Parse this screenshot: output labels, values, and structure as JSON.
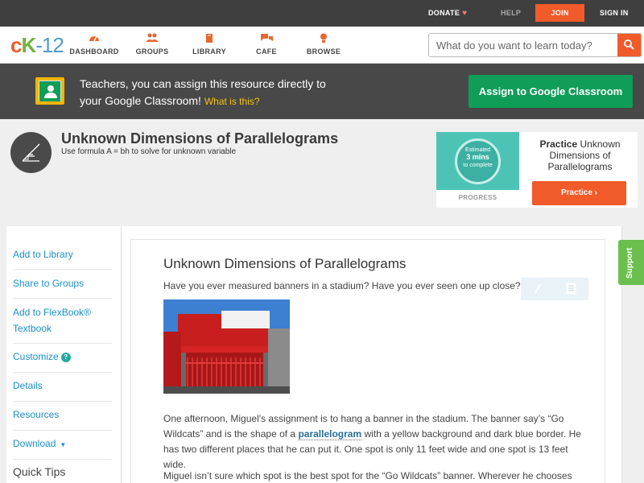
{
  "topbar": {
    "donate": "DONATE",
    "help": "HELP",
    "join": "JOIN",
    "signin": "SIGN IN"
  },
  "nav": {
    "logo": {
      "c": "c",
      "k": "K",
      "n": "-12"
    },
    "items": [
      {
        "label": "DASHBOARD",
        "icon": "dashboard-icon"
      },
      {
        "label": "GROUPS",
        "icon": "groups-icon"
      },
      {
        "label": "LIBRARY",
        "icon": "library-icon"
      },
      {
        "label": "CAFE",
        "icon": "cafe-icon"
      },
      {
        "label": "BROWSE",
        "icon": "browse-icon"
      }
    ],
    "search_placeholder": "What do you want to learn today?"
  },
  "classroom": {
    "text_line1": "Teachers, you can assign this resource directly to",
    "text_line2": "your Google Classroom!",
    "what": "What is this?",
    "button": "Assign to Google Classroom"
  },
  "lesson": {
    "title": "Unknown Dimensions of Parallelograms",
    "subtitle": "Use formula A = bh to solve for unknown variable"
  },
  "practice": {
    "estimated": "Estimated",
    "mins": "3 mins",
    "to_complete": "to complete",
    "progress": "PROGRESS",
    "title_bold": "Practice",
    "title_rest": "Unknown Dimensions of Parallelograms",
    "button": "Practice"
  },
  "sidebar": {
    "items": [
      {
        "label": "Add to Library"
      },
      {
        "label": "Share to Groups"
      },
      {
        "label": "Add to FlexBook®"
      },
      {
        "label": "Textbook"
      },
      {
        "label": "Customize"
      },
      {
        "label": "Details"
      },
      {
        "label": "Resources"
      },
      {
        "label": "Download"
      }
    ],
    "quick_tips": "Quick Tips"
  },
  "content": {
    "heading": "Unknown Dimensions of Parallelograms",
    "intro": "Have you ever measured banners in a stadium? Have you ever seen one up close?",
    "p1_a": "One afternoon, Miguel's assignment is to hang a banner in the stadium. The banner say’s “Go Wildcats” and is the shape of a",
    "p1_term": "parallelogram",
    "p1_b": "with a yellow background and dark blue border. He has two different places that he can put it. One spot is only 11 feet wide and one spot is 13 feet wide.",
    "p2": "Miguel isn’t sure which spot is the best spot for the “Go Wildcats” banner. Wherever he chooses"
  },
  "support": "Support",
  "colors": {
    "accent": "#f15a29",
    "google_green": "#0f9d58",
    "link": "#1a8fc7",
    "support": "#6bbf4e"
  }
}
